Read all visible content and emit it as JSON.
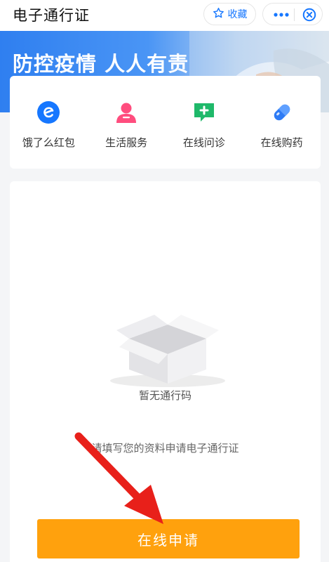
{
  "header": {
    "title": "电子通行证",
    "favorite_label": "收藏",
    "more_icon": "more-icon",
    "close_icon": "close-icon"
  },
  "banner": {
    "text": "防控疫情 人人有责"
  },
  "services": [
    {
      "label": "饿了么红包",
      "icon": "eleme-icon",
      "color": "#1677ff"
    },
    {
      "label": "生活服务",
      "icon": "person-icon",
      "color": "#ff4d7e"
    },
    {
      "label": "在线问诊",
      "icon": "medical-chat-icon",
      "color": "#1fb96a"
    },
    {
      "label": "在线购药",
      "icon": "pill-icon",
      "color": "#2e7bf5"
    }
  ],
  "main": {
    "empty_text": "暂无通行码",
    "hint_text": "请填写您的资料申请电子通行证",
    "apply_button": "在线申请"
  },
  "colors": {
    "accent_blue": "#1677ff",
    "button_orange": "#ffa10d",
    "annotation_red": "#e8201a"
  }
}
